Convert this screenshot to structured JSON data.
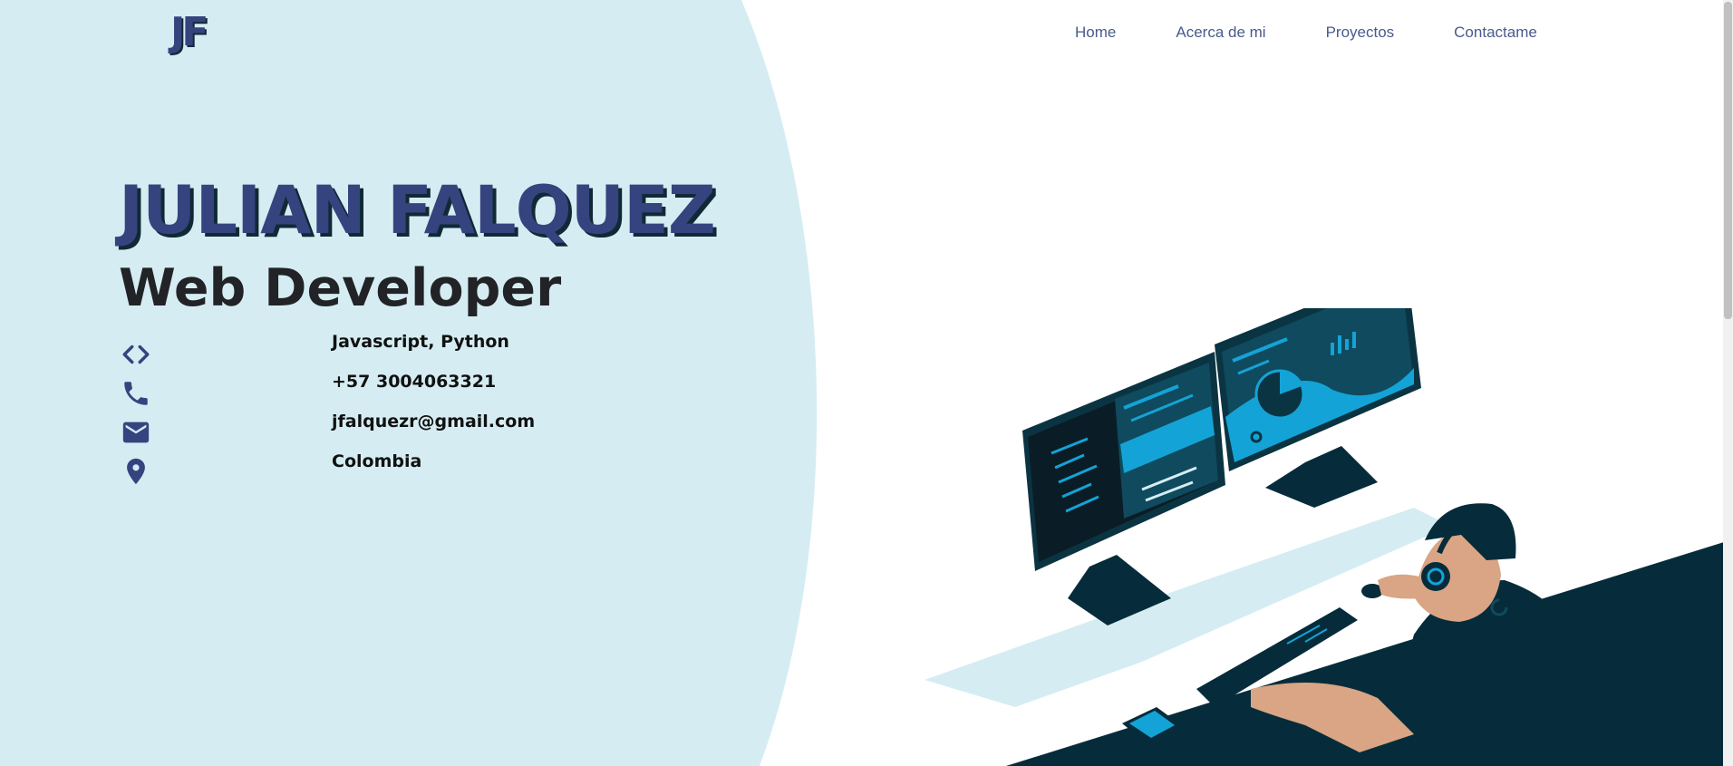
{
  "logo": {
    "text": "JF"
  },
  "nav": {
    "items": [
      {
        "label": "Home"
      },
      {
        "label": "Acerca de mi"
      },
      {
        "label": "Proyectos"
      },
      {
        "label": "Contactame"
      }
    ]
  },
  "hero": {
    "name": "JULIAN FALQUEZ",
    "role": "Web Developer"
  },
  "info": {
    "items": [
      {
        "icon": "code-icon",
        "text": "Javascript, Python"
      },
      {
        "icon": "phone-icon",
        "text": "+57 3004063321"
      },
      {
        "icon": "mail-icon",
        "text": "jfalquezr@gmail.com"
      },
      {
        "icon": "location-pin-icon",
        "text": "Colombia"
      }
    ]
  },
  "colors": {
    "panel_bg": "#d5edf2",
    "brand_blue": "#35447f",
    "dark_teal": "#062c3b",
    "accent_cyan": "#14a3d6",
    "skin": "#d9a584"
  }
}
